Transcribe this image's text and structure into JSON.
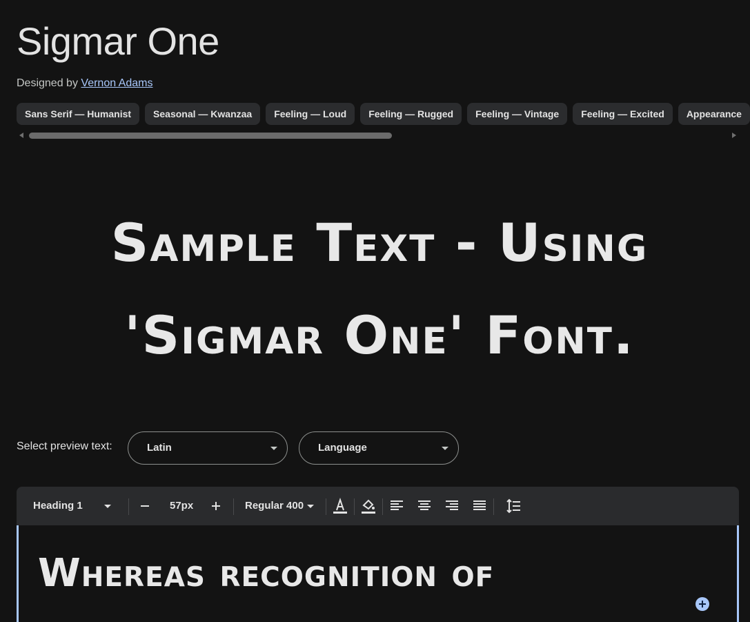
{
  "font": {
    "name": "Sigmar One",
    "designed_by_label": "Designed by",
    "designer": "Vernon Adams"
  },
  "tags": [
    "Sans Serif — Humanist",
    "Seasonal — Kwanzaa",
    "Feeling — Loud",
    "Feeling — Rugged",
    "Feeling — Vintage",
    "Feeling — Excited",
    "Appearance"
  ],
  "hero": {
    "line1": "Sample Text - Using",
    "line2": "'Sigmar One' Font."
  },
  "preview": {
    "label": "Select preview text:",
    "script_value": "Latin",
    "language_placeholder": "Language"
  },
  "toolbar": {
    "style": "Heading 1",
    "size": "57px",
    "weight": "Regular 400",
    "icons": [
      "minus-icon",
      "plus-icon",
      "text-color-icon",
      "fill-color-icon",
      "align-left-icon",
      "align-center-icon",
      "align-right-icon",
      "align-justify-icon",
      "line-height-icon"
    ]
  },
  "editor": {
    "text": "Whereas recognition of"
  },
  "colors": {
    "background": "#131313",
    "chip": "#2b2c2e",
    "link": "#a8c7fa",
    "accent": "#a8c7fa"
  }
}
